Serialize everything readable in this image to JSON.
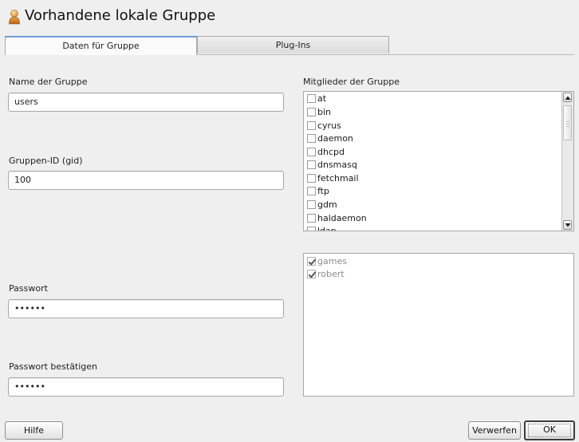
{
  "window": {
    "title": "Vorhandene lokale Gruppe",
    "icon": "user-group-icon"
  },
  "tabs": [
    {
      "label": "Daten für Gruppe",
      "active": true
    },
    {
      "label": "Plug-Ins",
      "active": false
    }
  ],
  "form": {
    "group_name": {
      "label": "Name der Gruppe",
      "value": "users"
    },
    "gid": {
      "label": "Gruppen-ID (gid)",
      "value": "100"
    },
    "password": {
      "label": "Passwort",
      "value": "••••••"
    },
    "password_confirm": {
      "label": "Passwort bestätigen",
      "value": "••••••"
    }
  },
  "members": {
    "label": "Mitglieder der Gruppe",
    "users": [
      {
        "name": "at",
        "checked": false
      },
      {
        "name": "bin",
        "checked": false
      },
      {
        "name": "cyrus",
        "checked": false
      },
      {
        "name": "daemon",
        "checked": false
      },
      {
        "name": "dhcpd",
        "checked": false
      },
      {
        "name": "dnsmasq",
        "checked": false
      },
      {
        "name": "fetchmail",
        "checked": false
      },
      {
        "name": "ftp",
        "checked": false
      },
      {
        "name": "gdm",
        "checked": false
      },
      {
        "name": "haldaemon",
        "checked": false
      },
      {
        "name": "ldap",
        "checked": false
      }
    ],
    "fixed_members": [
      {
        "name": "games",
        "checked": true
      },
      {
        "name": "robert",
        "checked": true
      }
    ]
  },
  "buttons": {
    "help": "Hilfe",
    "discard": "Verwerfen",
    "ok": "OK"
  }
}
